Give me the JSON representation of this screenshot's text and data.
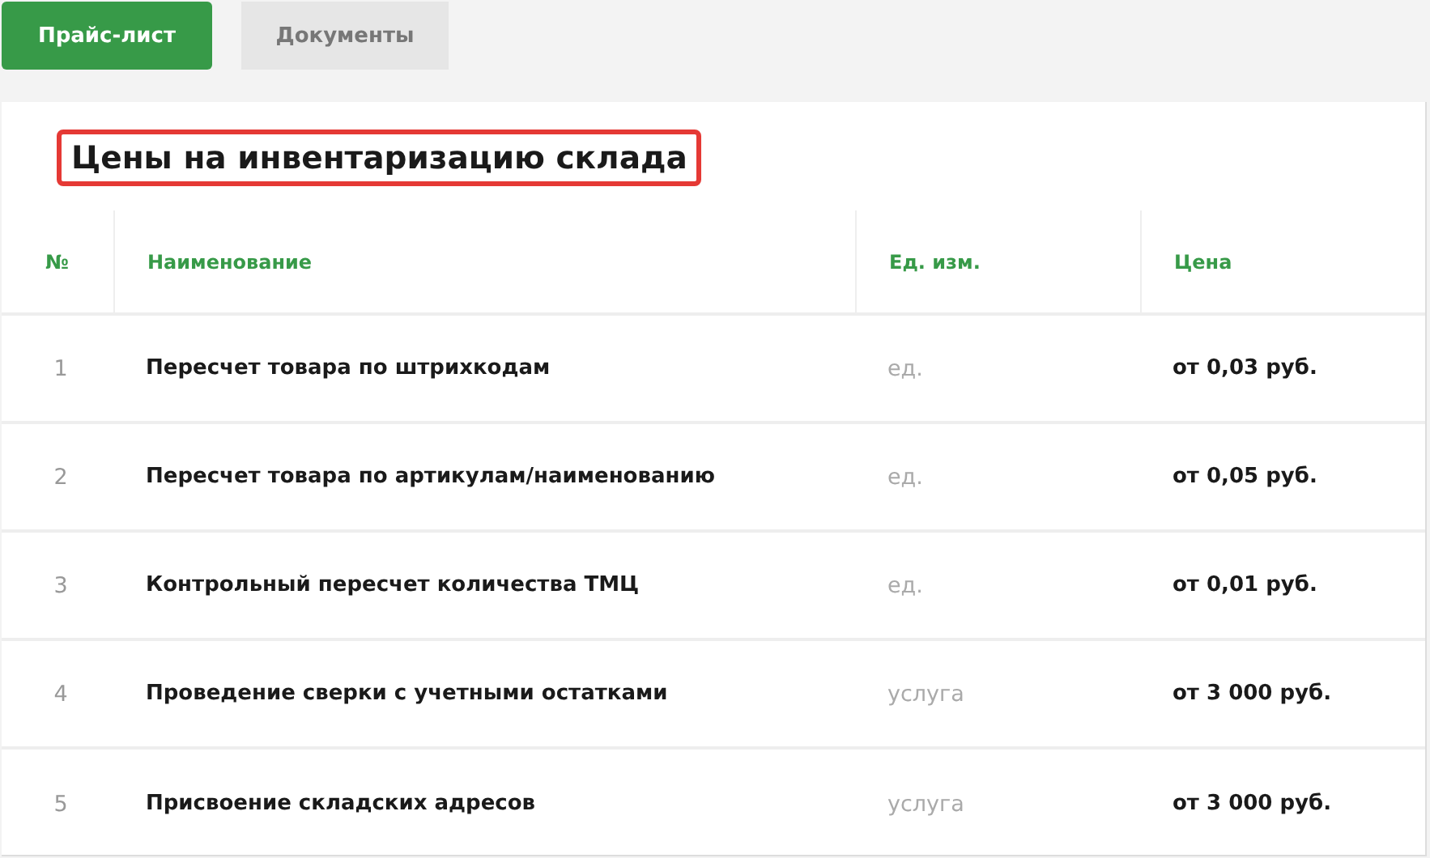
{
  "tabs": [
    {
      "label": "Прайс-лист",
      "selected": true
    },
    {
      "label": "Документы",
      "selected": false
    }
  ],
  "title": {
    "text": "Цены на инвентаризацию склада",
    "highlighted": true
  },
  "table": {
    "columns": [
      "№",
      "Наименование",
      "Ед. изм.",
      "Цена"
    ],
    "rows": [
      {
        "number": "1",
        "name": "Пересчет товара по штрихкодам",
        "unit": "ед.",
        "price": "от 0,03 руб."
      },
      {
        "number": "2",
        "name": "Пересчет товара по артикулам/наименованию",
        "unit": "ед.",
        "price": "от 0,05 руб."
      },
      {
        "number": "3",
        "name": "Контрольный пересчет количества ТМЦ",
        "unit": "ед.",
        "price": "от 0,01 руб."
      },
      {
        "number": "4",
        "name": "Проведение сверки с учетными остатками",
        "unit": "услуга",
        "price": "от 3 000 руб."
      },
      {
        "number": "5",
        "name": "Присвоение складских адресов",
        "unit": "услуга",
        "price": "от 3 000 руб."
      }
    ]
  }
}
